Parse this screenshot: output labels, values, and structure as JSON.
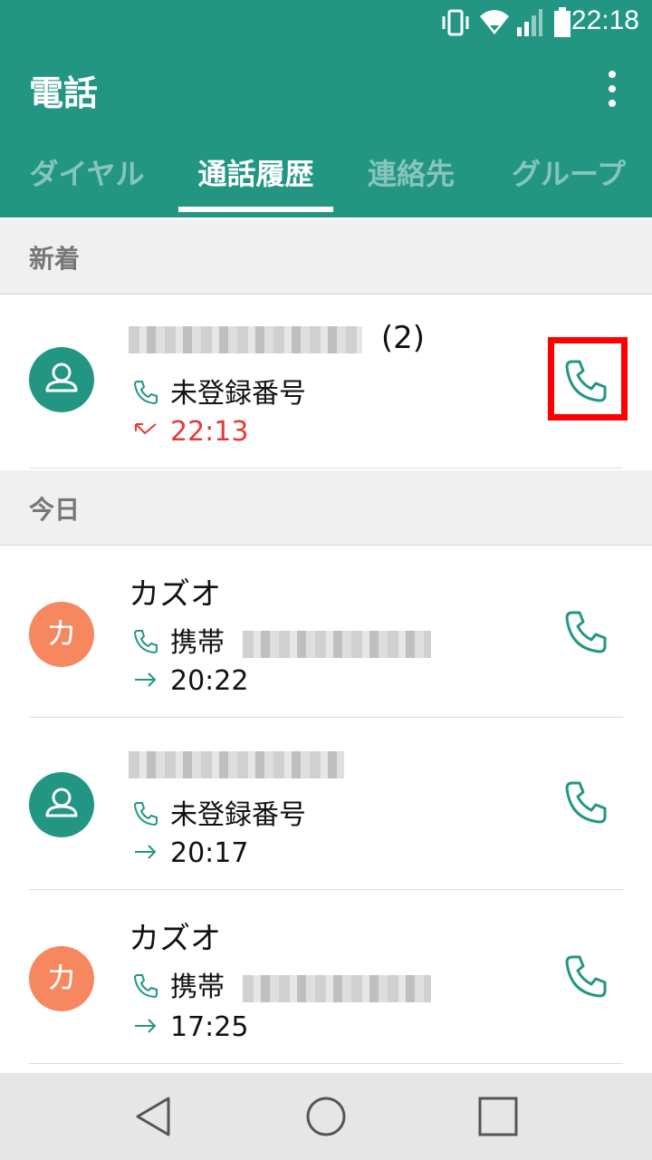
{
  "status_bar": {
    "time": "22:18"
  },
  "header": {
    "title": "電話",
    "tabs": [
      {
        "label": "ダイヤル",
        "active": false
      },
      {
        "label": "通話履歴",
        "active": true
      },
      {
        "label": "連絡先",
        "active": false
      },
      {
        "label": "グループ",
        "active": false
      }
    ]
  },
  "sections": [
    {
      "label": "新着"
    },
    {
      "label": "今日"
    }
  ],
  "calls": [
    {
      "name_hidden": true,
      "count": "(2)",
      "label": "未登録番号",
      "time": "22:13",
      "direction": "missed",
      "avatar": "person-icon"
    },
    {
      "name": "カズオ",
      "avatar_initial": "カ",
      "label": "携帯",
      "time": "20:22",
      "direction": "outgoing"
    },
    {
      "name_hidden": true,
      "label": "未登録番号",
      "time": "20:17",
      "direction": "outgoing",
      "avatar": "person-icon"
    },
    {
      "name": "カズオ",
      "avatar_initial": "カ",
      "label": "携帯",
      "time": "17:25",
      "direction": "outgoing"
    }
  ],
  "colors": {
    "primary": "#229683",
    "missed": "#e53935",
    "avatar_orange": "#f6875f",
    "highlight": "#ff0000"
  }
}
